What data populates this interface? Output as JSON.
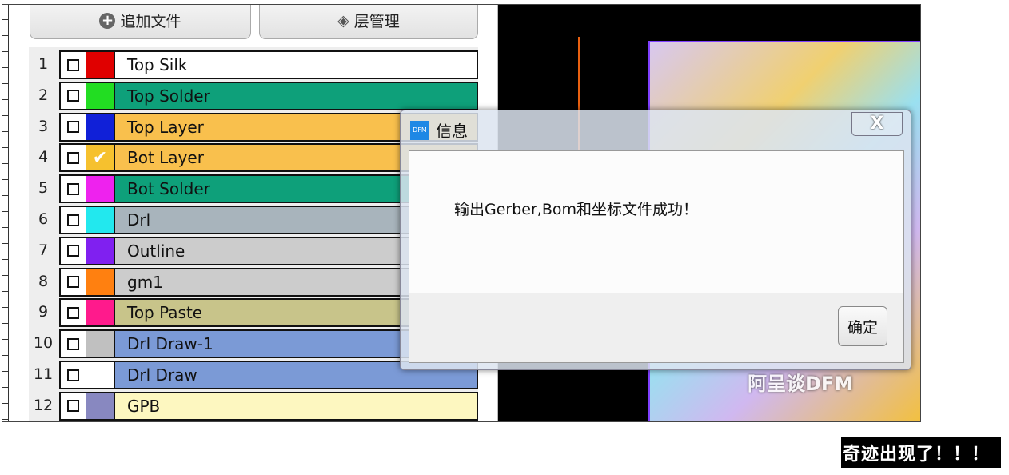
{
  "toolbar": {
    "add_file": "追加文件",
    "layer_manager": "层管理"
  },
  "layers": [
    {
      "num": "1",
      "name": "Top Silk",
      "color": "#e00000",
      "bg": "#ffffff",
      "checked": false
    },
    {
      "num": "2",
      "name": "Top Solder",
      "color": "#22dd22",
      "bg": "#0ea07a",
      "checked": false
    },
    {
      "num": "3",
      "name": "Top Layer",
      "color": "#1020d8",
      "bg": "#f9c04d",
      "checked": false
    },
    {
      "num": "4",
      "name": "Bot Layer",
      "color": "#f6c12e",
      "bg": "#f9c04d",
      "checked": true
    },
    {
      "num": "5",
      "name": "Bot Solder",
      "color": "#ee22ee",
      "bg": "#0ea07a",
      "checked": false
    },
    {
      "num": "6",
      "name": "Drl",
      "color": "#22e8ee",
      "bg": "#a8b4bc",
      "checked": false
    },
    {
      "num": "7",
      "name": "Outline",
      "color": "#8020f0",
      "bg": "#cccccc",
      "checked": false
    },
    {
      "num": "8",
      "name": "gm1",
      "color": "#ff8010",
      "bg": "#cccccc",
      "checked": false
    },
    {
      "num": "9",
      "name": "Top Paste",
      "color": "#ff1a8c",
      "bg": "#c8c48a",
      "checked": false
    },
    {
      "num": "10",
      "name": "Drl Draw-1",
      "color": "#c0c0c0",
      "bg": "#7b9ad6",
      "checked": false
    },
    {
      "num": "11",
      "name": "Drl Draw",
      "color": "#ffffff",
      "bg": "#7b9ad6",
      "checked": false
    },
    {
      "num": "12",
      "name": "GPB",
      "color": "#8888c0",
      "bg": "#fdf7c0",
      "checked": false
    }
  ],
  "dialog": {
    "logo": "DFM",
    "title": "信息",
    "close": "X",
    "message": "输出Gerber,Bom和坐标文件成功！",
    "ok": "确定"
  },
  "watermark": "阿呈谈DFM",
  "caption": "奇迹出现了！！！"
}
